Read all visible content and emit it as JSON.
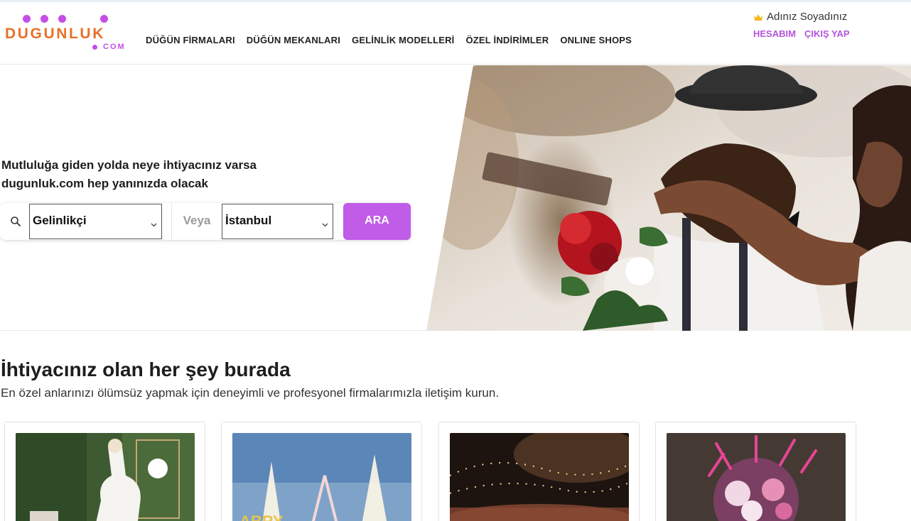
{
  "brand": {
    "logo_word": "DUGUNLUK",
    "logo_suffix": "COM",
    "colors": {
      "primary": "#c05ce8",
      "accent": "#e8702a",
      "link": "#b455d8"
    }
  },
  "nav": {
    "items": [
      "DÜĞÜN FİRMALARI",
      "DÜĞÜN MEKANLARI",
      "GELİNLİK MODELLERİ",
      "ÖZEL İNDİRİMLER",
      "ONLINE SHOPS"
    ]
  },
  "user": {
    "name": "Adınız Soyadınız",
    "icon": "crown-icon",
    "account_link": "HESABIM",
    "logout_link": "ÇIKIŞ YAP"
  },
  "hero": {
    "headline": "Mutluluğa giden yolda neye ihtiyacınız varsa dugunluk.com hep yanınızda olacak",
    "search": {
      "icon": "search-icon",
      "category_value": "Gelinlikçi",
      "separator_label": "Veya",
      "city_value": "İstanbul",
      "submit_label": "ARA"
    }
  },
  "section": {
    "title": "İhtiyacınız olan her şey burada",
    "subtitle": "En özel anlarınızı ölümsüz yapmak için deneyimli ve profesyonel firmalarımızla iletişim kurun."
  },
  "cards": [
    {
      "image": "bride-photo"
    },
    {
      "image": "fireworks-stage-photo"
    },
    {
      "image": "night-venue-photo"
    },
    {
      "image": "flower-bouquet-photo"
    }
  ]
}
